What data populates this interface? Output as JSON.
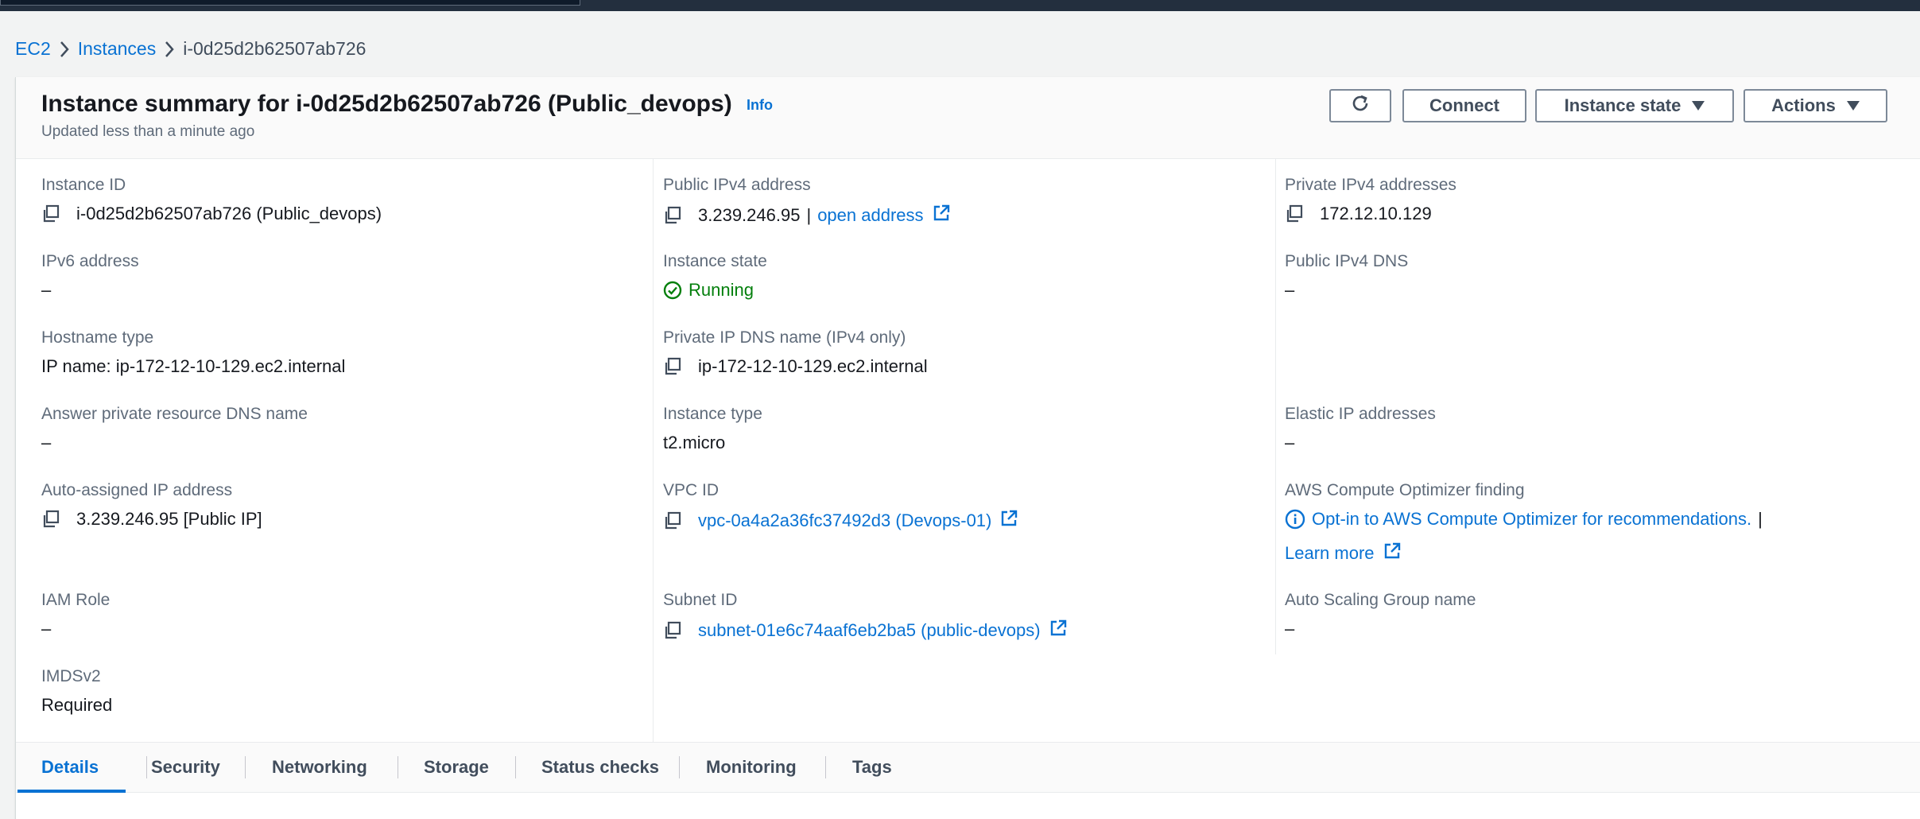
{
  "breadcrumb": {
    "ec2": "EC2",
    "instances": "Instances",
    "current": "i-0d25d2b62507ab726"
  },
  "header": {
    "title": "Instance summary for i-0d25d2b62507ab726 (Public_devops)",
    "info": "Info",
    "subtitle": "Updated less than a minute ago",
    "connect": "Connect",
    "instance_state": "Instance state",
    "actions": "Actions"
  },
  "details": {
    "instance_id": {
      "label": "Instance ID",
      "value": "i-0d25d2b62507ab726 (Public_devops)"
    },
    "ipv6": {
      "label": "IPv6 address",
      "value": "–"
    },
    "hostname_type": {
      "label": "Hostname type",
      "value": "IP name: ip-172-12-10-129.ec2.internal"
    },
    "answer_dns": {
      "label": "Answer private resource DNS name",
      "value": "–"
    },
    "auto_ip": {
      "label": "Auto-assigned IP address",
      "value": "3.239.246.95 [Public IP]"
    },
    "iam_role": {
      "label": "IAM Role",
      "value": "–"
    },
    "imdsv2": {
      "label": "IMDSv2",
      "value": "Required"
    },
    "public_ipv4": {
      "label": "Public IPv4 address",
      "value": "3.239.246.95",
      "divider": "|",
      "link": "open address"
    },
    "instance_state": {
      "label": "Instance state",
      "value": "Running"
    },
    "private_dns": {
      "label": "Private IP DNS name (IPv4 only)",
      "value": "ip-172-12-10-129.ec2.internal"
    },
    "instance_type": {
      "label": "Instance type",
      "value": "t2.micro"
    },
    "vpc_id": {
      "label": "VPC ID",
      "value": "vpc-0a4a2a36fc37492d3 (Devops-01)"
    },
    "subnet_id": {
      "label": "Subnet ID",
      "value": "subnet-01e6c74aaf6eb2ba5 (public-devops)"
    },
    "private_ipv4": {
      "label": "Private IPv4 addresses",
      "value": "172.12.10.129"
    },
    "public_dns": {
      "label": "Public IPv4 DNS",
      "value": "–"
    },
    "elastic_ip": {
      "label": "Elastic IP addresses",
      "value": "–"
    },
    "optimizer": {
      "label": "AWS Compute Optimizer finding",
      "link": "Opt-in to AWS Compute Optimizer for recommendations.",
      "divider": "|",
      "learn_more": "Learn more"
    },
    "asg": {
      "label": "Auto Scaling Group name",
      "value": "–"
    }
  },
  "tabs": [
    "Details",
    "Security",
    "Networking",
    "Storage",
    "Status checks",
    "Monitoring",
    "Tags"
  ],
  "colors": {
    "link": "#0972d3",
    "running": "#037f0c",
    "topbar": "#232f3e"
  }
}
